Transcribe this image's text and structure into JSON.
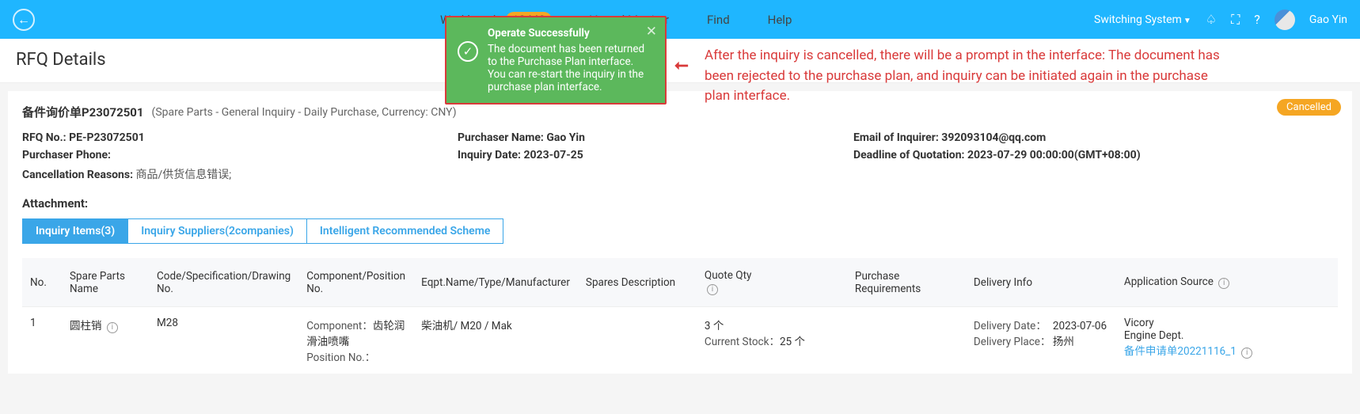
{
  "topbar": {
    "nav": {
      "workbench": "Workbench",
      "workbench_count": "10443",
      "vessel": "Vessel Monitor",
      "find": "Find",
      "help": "Help"
    },
    "switching": "Switching System",
    "username": "Gao Yin"
  },
  "page_title": "RFQ Details",
  "doc": {
    "id": "备件询价单P23072501",
    "desc": "(Spare Parts - General Inquiry - Daily Purchase, Currency: CNY)",
    "status_badge": "Cancelled"
  },
  "info": {
    "rfq_no_label": "RFQ No.: ",
    "rfq_no": "PE-P23072501",
    "purchaser_name_label": "Purchaser Name: ",
    "purchaser_name": "Gao Yin",
    "inquirer_email_label": "Email of Inquirer: ",
    "inquirer_email": "392093104@qq.com",
    "purchaser_phone_label": "Purchaser Phone:",
    "inquiry_date_label": "Inquiry Date: ",
    "inquiry_date": "2023-07-25",
    "deadline_label": "Deadline of Quotation: ",
    "deadline": "2023-07-29 00:00:00(GMT+08:00)",
    "cancel_reason_label": "Cancellation Reasons: ",
    "cancel_reason": "商品/供货信息错误;"
  },
  "attachment_label": "Attachment:",
  "tabs": {
    "items": "Inquiry Items(3)",
    "suppliers": "Inquiry Suppliers(2companies)",
    "scheme": "Intelligent Recommended Scheme"
  },
  "columns": {
    "no": "No.",
    "spare_name": "Spare Parts Name",
    "code": "Code/Specification/Drawing No.",
    "component": "Component/Position No.",
    "eqpt": "Eqpt.Name/Type/Manufacturer",
    "desc": "Spares Description",
    "qty": "Quote Qty",
    "req": "Purchase Requirements",
    "delivery": "Delivery Info",
    "appsrc": "Application Source"
  },
  "row": {
    "no": "1",
    "name": "圆柱销",
    "code": "M28",
    "comp_label": "Component：",
    "comp_value": "齿轮润滑油喷嘴",
    "pos_label": "Position No.：",
    "eqpt": "柴油机/ M20 / Mak",
    "qty": "3 个",
    "stock_label": "Current Stock：",
    "stock_value": "25 个",
    "del_date_label": "Delivery Date：",
    "del_date": "2023-07-06",
    "del_place_label": "Delivery Place：",
    "del_place": "扬州",
    "src1": "Vicory",
    "src2": "Engine Dept.",
    "src3": "备件申请单20221116_1"
  },
  "toast": {
    "title": "Operate Successfully",
    "body": "The document has been returned to the Purchase Plan interface. You can re-start the inquiry in the purchase plan interface."
  },
  "annotation": "After the inquiry is cancelled, there will be a prompt in the interface: The document has been rejected to the purchase plan, and inquiry can be initiated again in the purchase plan interface."
}
